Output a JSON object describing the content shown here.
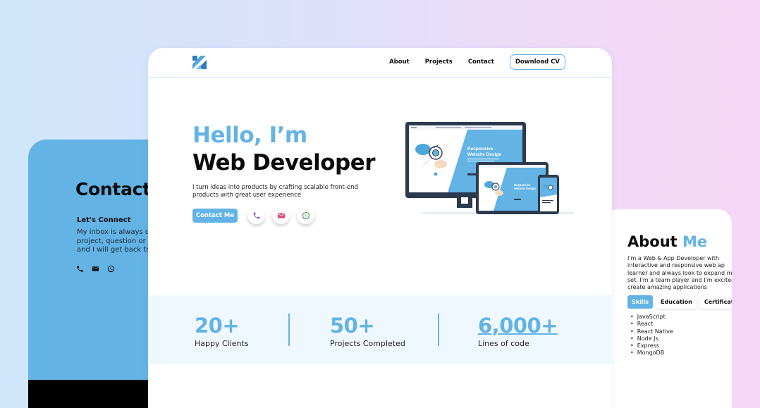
{
  "contact_card": {
    "title": "Contact",
    "subtitle": "Let's Connect",
    "text_lines": [
      "My inbox is always op",
      "project, question or ju",
      "and I will get back to"
    ],
    "icons": [
      "phone-icon",
      "mail-icon",
      "whatsapp-icon"
    ]
  },
  "about_card": {
    "title_main": "About ",
    "title_accent": "Me",
    "text_lines": [
      "I'm a Web & App Developer with",
      "interactive and responsive web ap",
      "learner and always look to expand m",
      "set. I'm a team player and I'm excited",
      "create amazing applications"
    ],
    "tabs": [
      {
        "label": "Skills",
        "active": true
      },
      {
        "label": "Education",
        "active": false
      },
      {
        "label": "Certificatio",
        "active": false
      }
    ],
    "skills": [
      "JavaScript",
      "React",
      "React Native",
      "Node Js",
      "Express",
      "MongoDB"
    ]
  },
  "nav": {
    "logo": "logo-icon",
    "links": [
      "About",
      "Projects",
      "Contact"
    ],
    "cv_button": "Download CV"
  },
  "hero": {
    "greeting": "Hello, I’m",
    "role": "Web Developer",
    "description": "I turn ideas into products by crafting scalable front-end products with great user experience",
    "cta": "Contact Me",
    "social": [
      "phone-icon",
      "mail-icon",
      "whatsapp-icon"
    ],
    "illustration_text_desktop": "Responsive Website Design",
    "illustration_text_tablet": "Responsive Website Design"
  },
  "stats": [
    {
      "number": "20+",
      "label": "Happy Clients"
    },
    {
      "number": "50+",
      "label": "Projects Completed"
    },
    {
      "number": "6,000+",
      "label": "Lines of code"
    }
  ],
  "colors": {
    "accent": "#63b3e5",
    "phone": "#9b59d0",
    "mail": "#e0457b",
    "whatsapp": "#25a244"
  }
}
